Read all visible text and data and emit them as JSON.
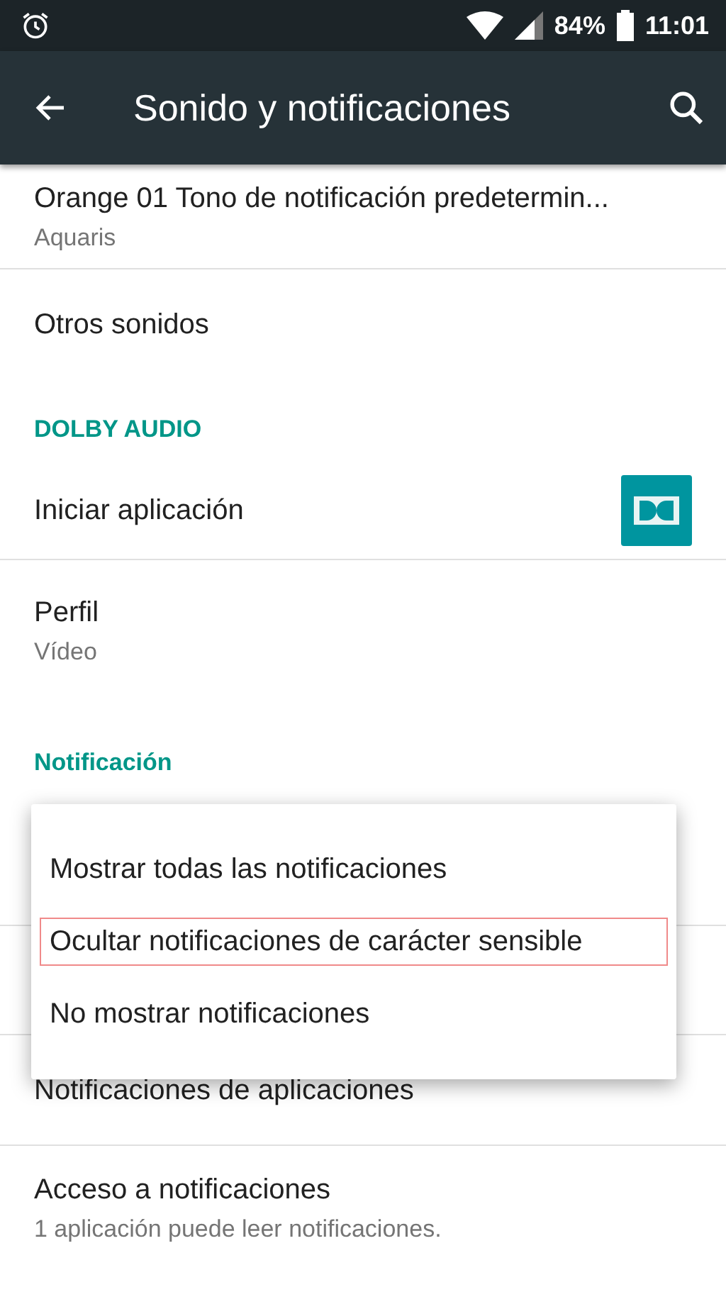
{
  "status_bar": {
    "battery": "84%",
    "time": "11:01"
  },
  "toolbar": {
    "title": "Sonido y notificaciones"
  },
  "list": [
    {
      "kind": "item",
      "title": "Orange 01 Tono de notificación predetermin...",
      "subtitle": "Aquaris"
    },
    {
      "kind": "item",
      "title": "Otros sonidos"
    },
    {
      "kind": "header",
      "title": "DOLBY AUDIO"
    },
    {
      "kind": "app",
      "title": "Iniciar aplicación"
    },
    {
      "kind": "item",
      "title": "Perfil",
      "subtitle": "Vídeo"
    },
    {
      "kind": "header",
      "title": "Notificación"
    },
    {
      "kind": "covered"
    },
    {
      "kind": "covered"
    },
    {
      "kind": "item",
      "title": "Notificaciones de aplicaciones"
    },
    {
      "kind": "item",
      "title": "Acceso a notificaciones",
      "subtitle": "1 aplicación puede leer notificaciones."
    }
  ],
  "popup": [
    {
      "label": "Mostrar todas las notificaciones",
      "focused": false
    },
    {
      "label": "Ocultar notificaciones de carácter sensible",
      "focused": true
    },
    {
      "label": "No mostrar notificaciones",
      "focused": false
    }
  ]
}
